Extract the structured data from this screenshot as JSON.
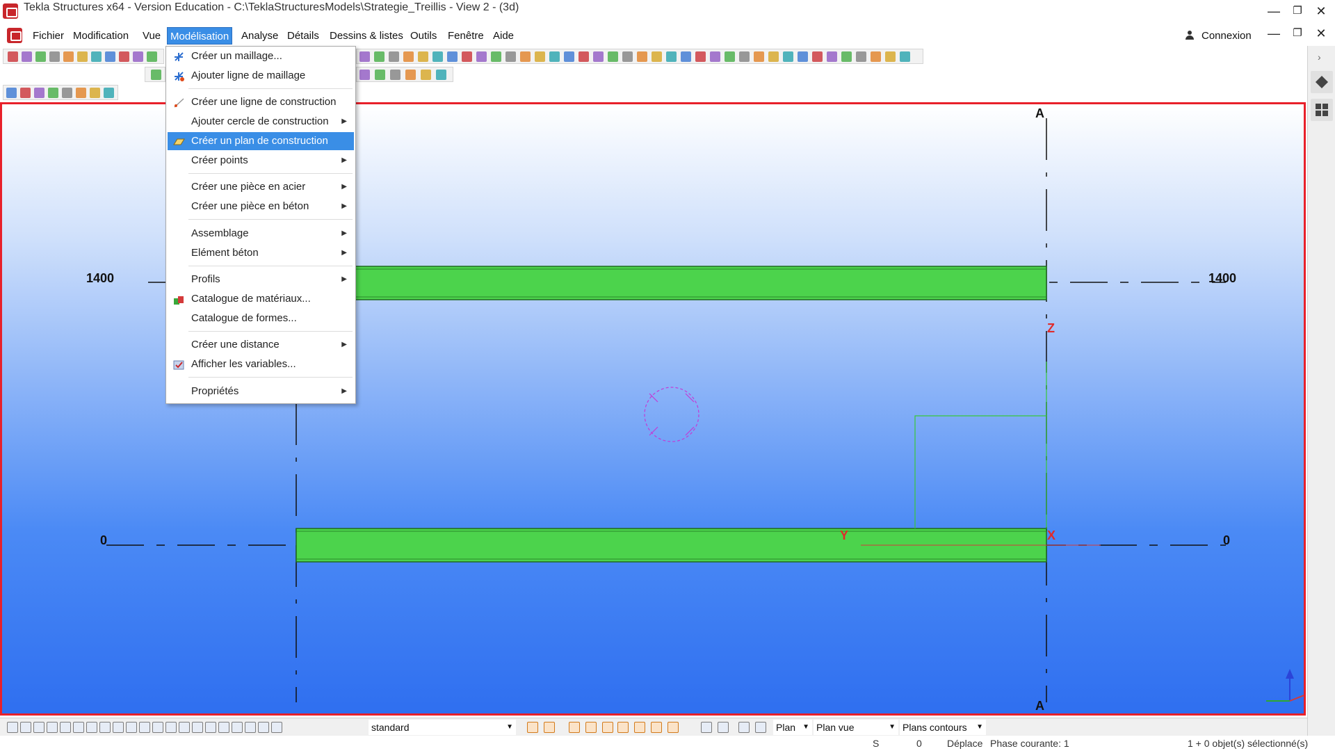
{
  "window": {
    "title": "Tekla Structures x64 - Version Education - C:\\TeklaStructuresModels\\Strategie_Treillis  - View 2 - (3d)",
    "minimize": "—",
    "maximize": "❐",
    "close": "✕"
  },
  "menubar": {
    "items": [
      "Fichier",
      "Modification",
      "Vue",
      "Modélisation",
      "Analyse",
      "Détails",
      "Dessins & listes",
      "Outils",
      "Fenêtre",
      "Aide"
    ],
    "active": "Modélisation",
    "connexion": "Connexion",
    "doc_minimize": "—",
    "doc_restore": "❐",
    "doc_close": "✕"
  },
  "dropdown": {
    "items": [
      {
        "label": "Créer un maillage...",
        "submenu": false
      },
      {
        "label": "Ajouter ligne de maillage",
        "submenu": false
      },
      {
        "label": "Créer une ligne de construction",
        "submenu": false
      },
      {
        "label": "Ajouter cercle de construction",
        "submenu": true
      },
      {
        "label": "Créer un plan de construction",
        "submenu": false,
        "highlighted": true
      },
      {
        "label": "Créer points",
        "submenu": true
      },
      {
        "label": "Créer une pièce en acier",
        "submenu": true
      },
      {
        "label": "Créer une pièce en béton",
        "submenu": true
      },
      {
        "label": "Assemblage",
        "submenu": true
      },
      {
        "label": "Elément béton",
        "submenu": true
      },
      {
        "label": "Profils",
        "submenu": true
      },
      {
        "label": "Catalogue de matériaux...",
        "submenu": false
      },
      {
        "label": "Catalogue de formes...",
        "submenu": false
      },
      {
        "label": "Créer une distance",
        "submenu": true
      },
      {
        "label": "Afficher les variables...",
        "submenu": false
      },
      {
        "label": "Propriétés",
        "submenu": true
      }
    ],
    "arrow": "▶"
  },
  "viewport": {
    "grid_label_top": "A",
    "grid_label_bottom": "A",
    "level_upper_left": "1400",
    "level_upper_right": "1400",
    "level_lower_left": "0",
    "level_lower_right": "0",
    "axis_z": "Z",
    "axis_y": "Y",
    "axis_x": "X",
    "beam_color": "#4cd34c",
    "border_color": "#e8202a"
  },
  "bottombar": {
    "filter_value": "standard",
    "plane_value": "Plan",
    "view_plane_value": "Plan vue",
    "contour_value": "Plans contours",
    "caret": "▼"
  },
  "statusbar": {
    "s_label": "S",
    "count": "0",
    "mode": "Déplace",
    "phase": "Phase courante: 1",
    "selection": "1 + 0 objet(s) sélectionné(s)"
  }
}
